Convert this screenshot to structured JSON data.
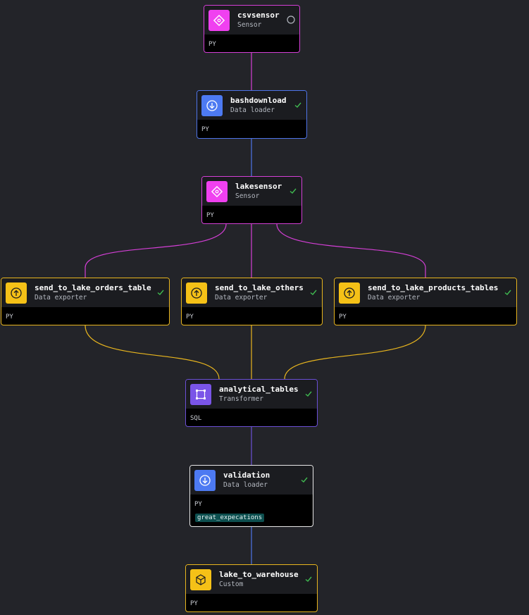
{
  "colors": {
    "background": "#232429",
    "sensor": "#d43fd6",
    "loader": "#4e74e8",
    "exporter": "#e8b51e",
    "transformer": "#6b4fd6",
    "custom": "#e8b51e",
    "success_check": "#3fb950",
    "tag_bg": "#0d4f4f"
  },
  "nodes": {
    "csvsensor": {
      "name": "csvsensor",
      "type": "Sensor",
      "lang": "PY",
      "status": "pending",
      "icon": "sensor-icon"
    },
    "bashdownload": {
      "name": "bashdownload",
      "type": "Data loader",
      "lang": "PY",
      "status": "success",
      "icon": "download-icon"
    },
    "lakesensor": {
      "name": "lakesensor",
      "type": "Sensor",
      "lang": "PY",
      "status": "success",
      "icon": "sensor-icon"
    },
    "orders": {
      "name": "send_to_lake_orders_table",
      "type": "Data exporter",
      "lang": "PY",
      "status": "success",
      "icon": "upload-icon"
    },
    "others": {
      "name": "send_to_lake_others",
      "type": "Data exporter",
      "lang": "PY",
      "status": "success",
      "icon": "upload-icon"
    },
    "products": {
      "name": "send_to_lake_products_tables",
      "type": "Data exporter",
      "lang": "PY",
      "status": "success",
      "icon": "upload-icon"
    },
    "analytical": {
      "name": "analytical_tables",
      "type": "Transformer",
      "lang": "SQL",
      "status": "success",
      "icon": "transformer-icon"
    },
    "validation": {
      "name": "validation",
      "type": "Data loader",
      "lang": "PY",
      "status": "success",
      "icon": "download-icon",
      "tag": "great_expecations"
    },
    "warehouse": {
      "name": "lake_to_warehouse",
      "type": "Custom",
      "lang": "PY",
      "status": "success",
      "icon": "cube-icon"
    }
  }
}
